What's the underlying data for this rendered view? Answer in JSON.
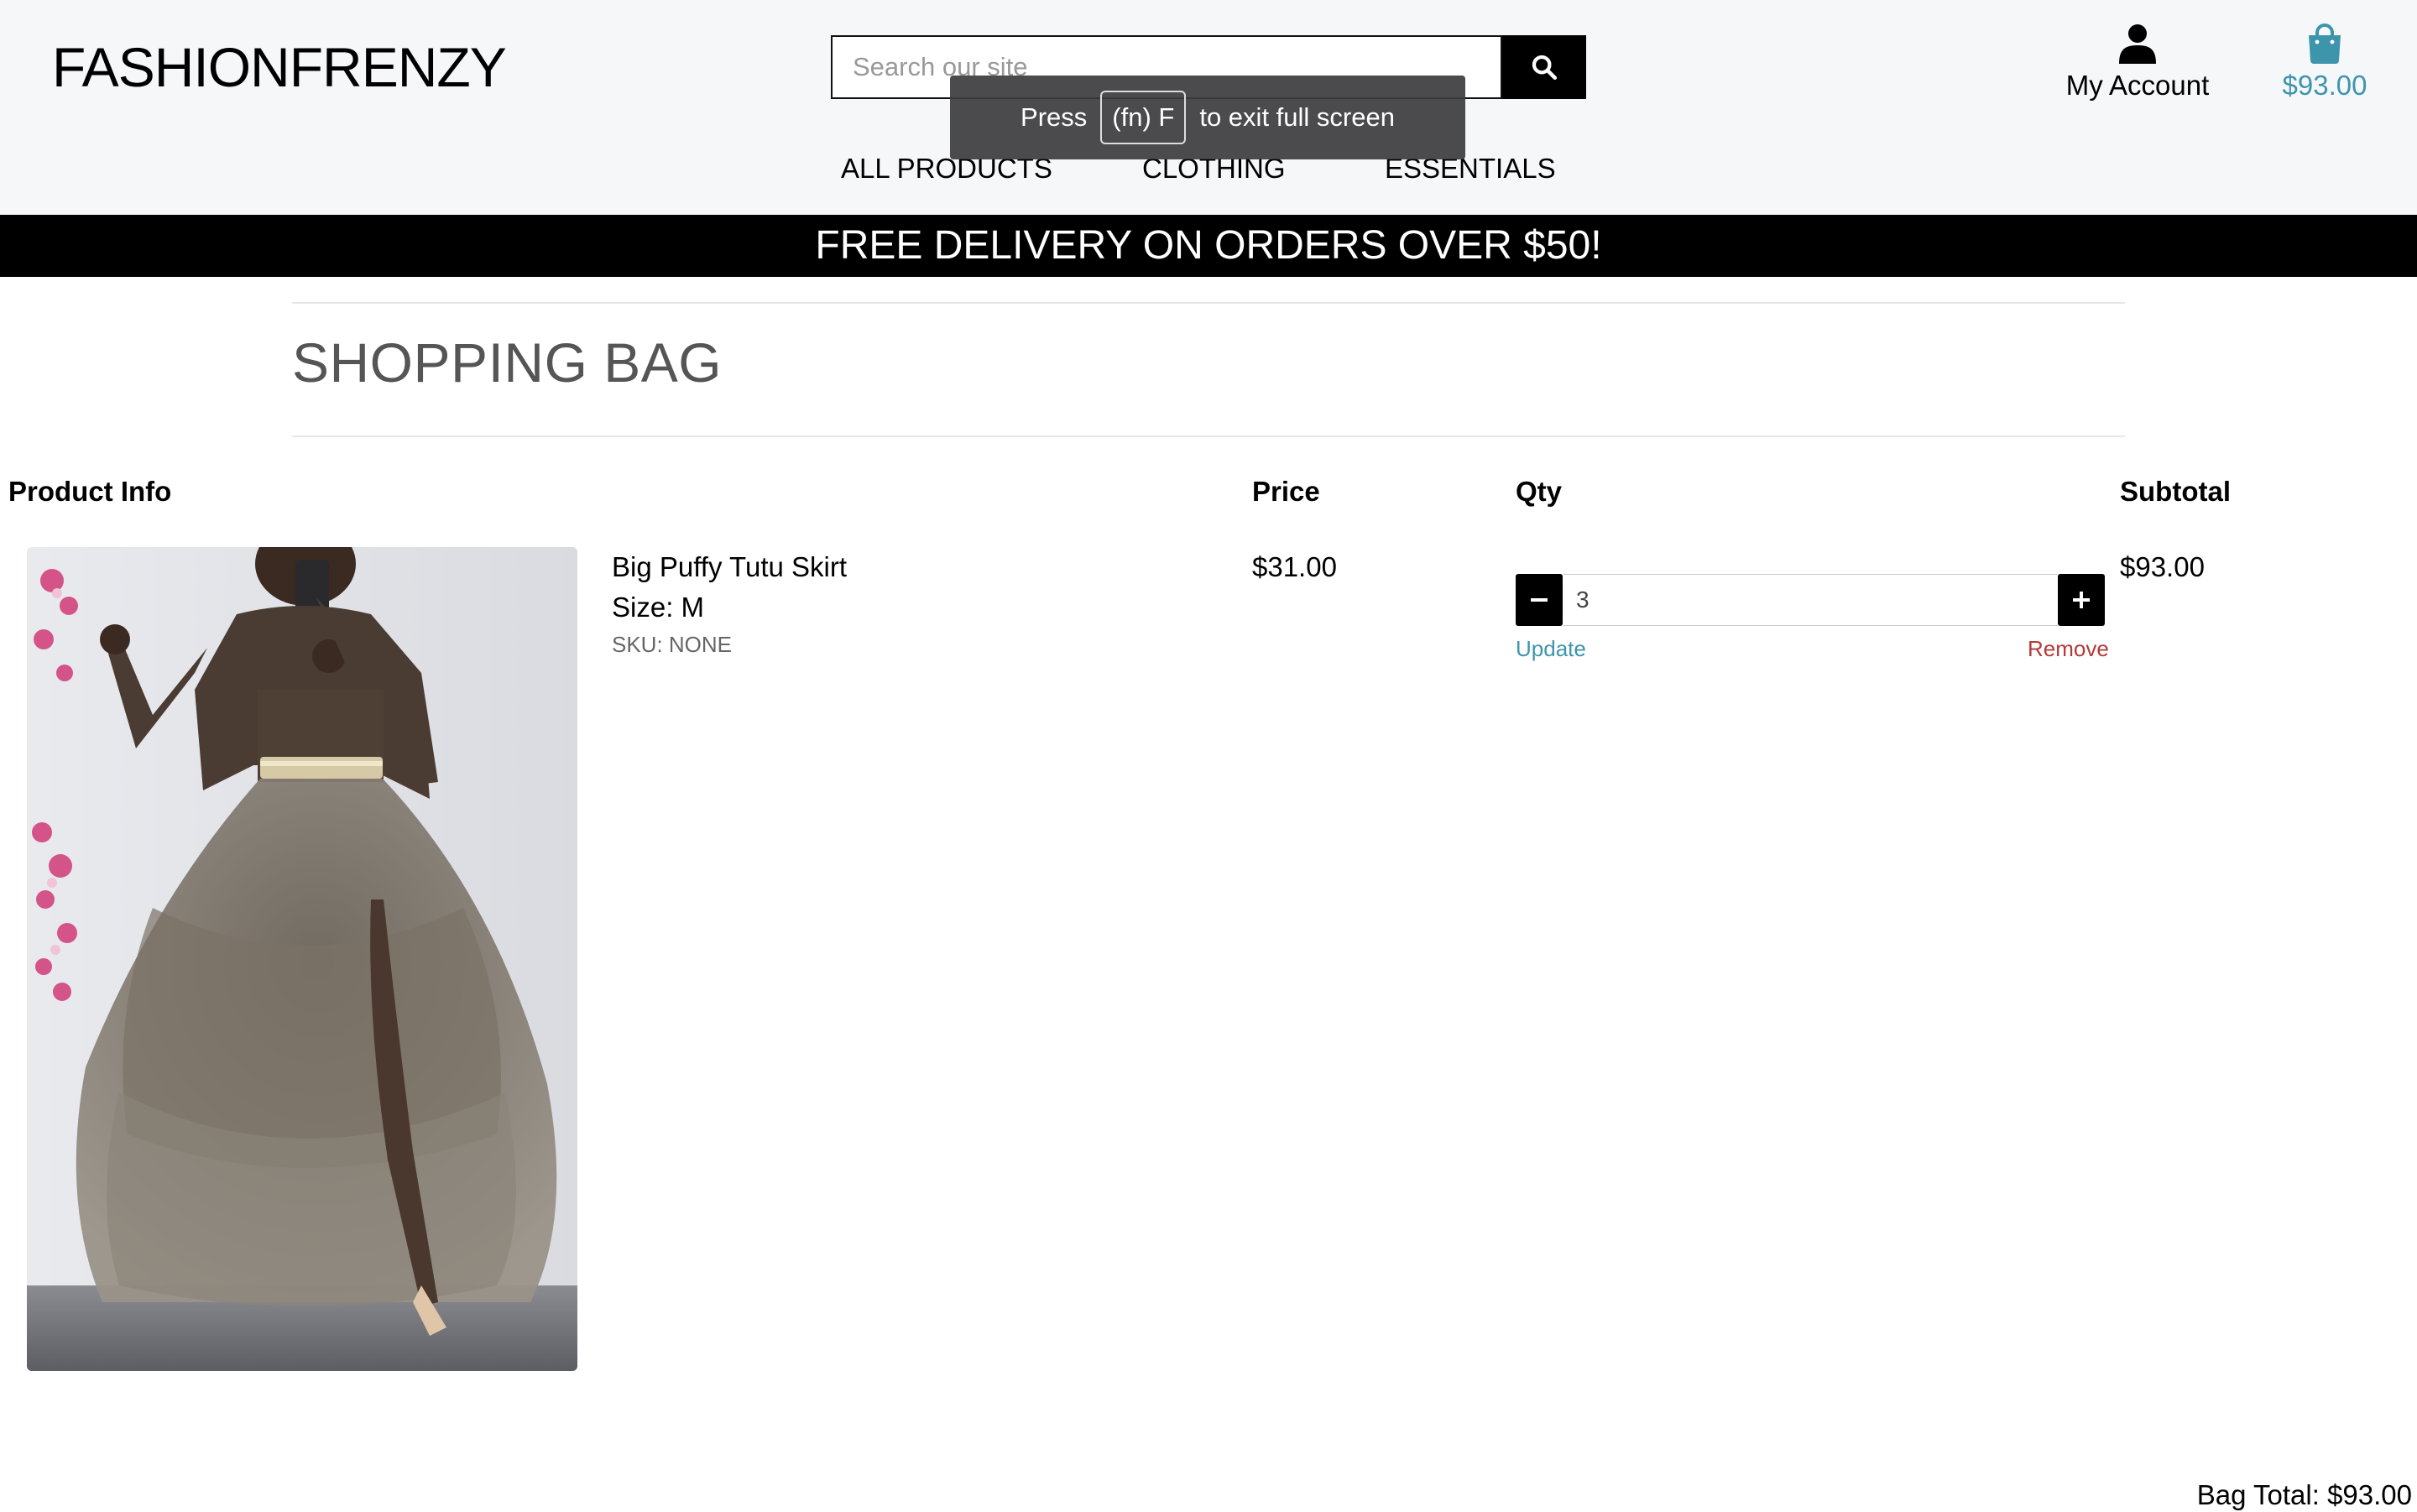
{
  "header": {
    "logo": "FASHIONFRENZY",
    "search": {
      "placeholder": "Search our site"
    },
    "account_label": "My Account",
    "bag_total": "$93.00",
    "nav": [
      {
        "label": "ALL PRODUCTS"
      },
      {
        "label": "CLOTHING"
      },
      {
        "label": "ESSENTIALS"
      }
    ]
  },
  "fullscreen_toast": {
    "prefix": "Press",
    "key": "(fn) F",
    "suffix": "to exit full screen"
  },
  "banner": {
    "text": "FREE DELIVERY ON ORDERS OVER $50!"
  },
  "page": {
    "title": "SHOPPING BAG"
  },
  "table": {
    "headers": {
      "product_info": "Product Info",
      "price": "Price",
      "qty": "Qty",
      "subtotal": "Subtotal"
    },
    "rows": [
      {
        "name": "Big Puffy Tutu Skirt",
        "size": "Size: M",
        "sku": "SKU: NONE",
        "price": "$31.00",
        "qty": "3",
        "subtotal": "$93.00",
        "update_label": "Update",
        "remove_label": "Remove"
      }
    ]
  },
  "summary": {
    "bag_total": "Bag Total: $93.00"
  },
  "colors": {
    "accent": "#3d95ac",
    "remove": "#b33a3a",
    "banner_bg": "#000000",
    "header_bg": "#f6f7f9"
  },
  "icons": {
    "search": "search-icon",
    "account": "user-icon",
    "bag": "shopping-bag-icon",
    "minus": "minus-icon",
    "plus": "plus-icon"
  }
}
